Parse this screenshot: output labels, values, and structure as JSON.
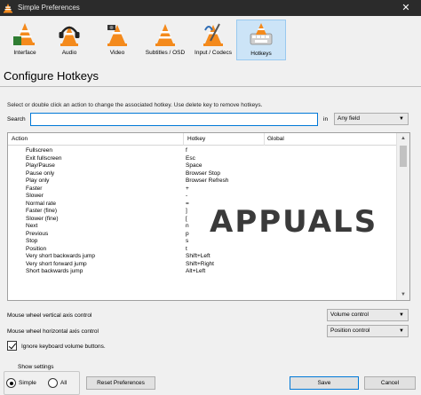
{
  "window": {
    "title": "Simple Preferences",
    "close_glyph": "✕"
  },
  "toolbar": {
    "items": [
      {
        "label": "Interface",
        "icon": "interface-cone-icon",
        "active": false
      },
      {
        "label": "Audio",
        "icon": "audio-headphones-cone-icon",
        "active": false
      },
      {
        "label": "Video",
        "icon": "video-cone-icon",
        "active": false
      },
      {
        "label": "Subtitles / OSD",
        "icon": "subtitles-cone-icon",
        "active": false
      },
      {
        "label": "Input / Codecs",
        "icon": "input-codecs-cone-icon",
        "active": false
      },
      {
        "label": "Hotkeys",
        "icon": "hotkeys-cone-icon",
        "active": true
      }
    ]
  },
  "page": {
    "heading": "Configure Hotkeys",
    "description": "Select or double click an action to change the associated hotkey. Use delete key to remove hotkeys."
  },
  "search": {
    "label": "Search",
    "value": "",
    "in_label": "in",
    "field_select": "Any field"
  },
  "table": {
    "columns": [
      "Action",
      "Hotkey",
      "Global"
    ],
    "rows": [
      [
        "Fullscreen",
        "f"
      ],
      [
        "Exit fullscreen",
        "Esc"
      ],
      [
        "Play/Pause",
        "Space"
      ],
      [
        "Pause only",
        "Browser Stop"
      ],
      [
        "Play only",
        "Browser Refresh"
      ],
      [
        "Faster",
        "+"
      ],
      [
        "Slower",
        "-"
      ],
      [
        "Normal rate",
        "="
      ],
      [
        "Faster (fine)",
        "]"
      ],
      [
        "Slower (fine)",
        "["
      ],
      [
        "Next",
        "n"
      ],
      [
        "Previous",
        "p"
      ],
      [
        "Stop",
        "s"
      ],
      [
        "Position",
        "t"
      ],
      [
        "Very short backwards jump",
        "Shift+Left"
      ],
      [
        "Very short forward jump",
        "Shift+Right"
      ],
      [
        "Short backwards jump",
        "Alt+Left"
      ]
    ]
  },
  "watermark": {
    "text": "APPUALS"
  },
  "mouse": {
    "vertical_label": "Mouse wheel vertical axis control",
    "vertical_value": "Volume control",
    "horizontal_label": "Mouse wheel horizontal axis control",
    "horizontal_value": "Position control"
  },
  "keyboard": {
    "ignore_volume_label": "Ignore keyboard volume buttons.",
    "ignore_volume_checked": true
  },
  "show_settings": {
    "title": "Show settings",
    "simple_label": "Simple",
    "all_label": "All",
    "selected": "Simple"
  },
  "buttons": {
    "reset": "Reset Preferences",
    "save": "Save",
    "cancel": "Cancel"
  },
  "colors": {
    "titlebar": "#2b2b2b",
    "active_tab": "#cce4f7",
    "focus_border": "#0078d7",
    "cone_orange": "#f48a1c"
  }
}
